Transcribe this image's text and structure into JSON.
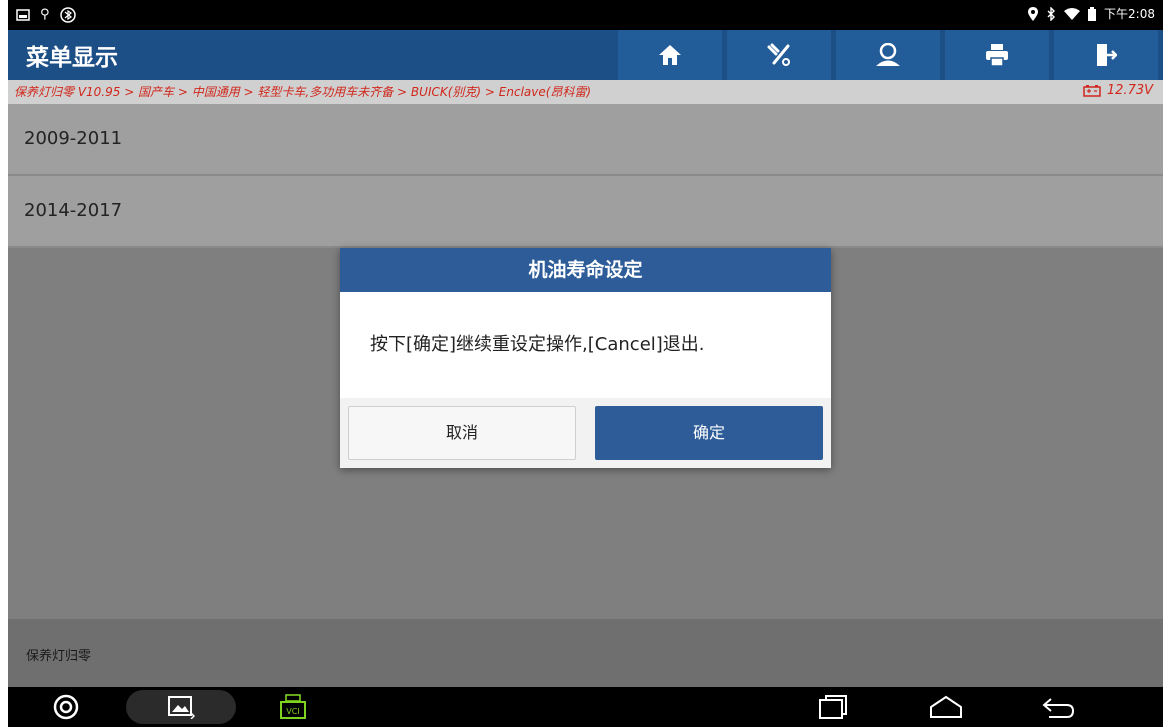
{
  "status_bar": {
    "time": "下午2:08",
    "left_icons": [
      "screen-icon",
      "usb-icon",
      "bluetooth-circle-icon"
    ],
    "right_icons": [
      "location-icon",
      "bluetooth-icon",
      "wifi-icon",
      "battery-icon"
    ]
  },
  "header": {
    "title": "菜单显示",
    "buttons": [
      "home-icon",
      "diagnose-tool-icon",
      "user-icon",
      "print-icon",
      "exit-icon"
    ]
  },
  "breadcrumb": {
    "path": "保养灯归零 V10.95 > 国产车 > 中国通用 > 轻型卡车,多功用车未齐备 > BUICK(别克) > Enclave(昂科雷)",
    "voltage": "12.73V"
  },
  "list": {
    "items": [
      {
        "label": "2009-2011"
      },
      {
        "label": "2014-2017"
      }
    ]
  },
  "footer": {
    "label": "保养灯归零"
  },
  "dialog": {
    "title": "机油寿命设定",
    "message": "按下[确定]继续重设定操作,[Cancel]退出.",
    "cancel_label": "取消",
    "ok_label": "确定"
  },
  "colors": {
    "header_bg": "#1c4f86",
    "accent": "#2d5c98",
    "breadcrumb_text": "#d0271c",
    "vci_green": "#7ed321"
  }
}
